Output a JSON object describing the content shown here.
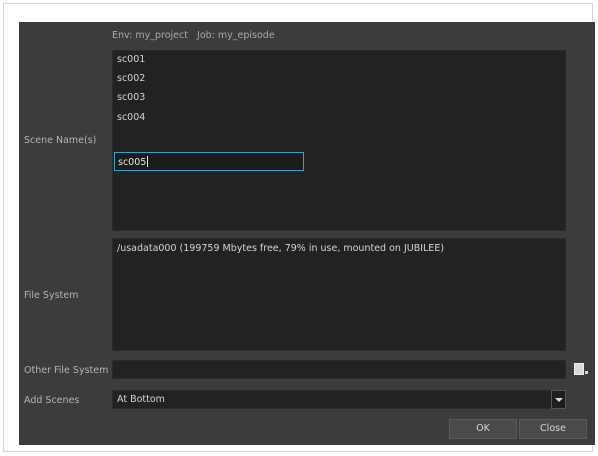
{
  "header": {
    "env_label": "Env: my_project",
    "job_label": "Job: my_episode"
  },
  "scene_names": {
    "label": "Scene Name(s)",
    "items": [
      "sc001",
      "sc002",
      "sc003",
      "sc004"
    ],
    "editing_value": "sc005"
  },
  "file_system": {
    "label": "File System",
    "entry": "/usadata000  (199759 Mbytes free, 79% in use, mounted on JUBILEE)"
  },
  "other_file_system": {
    "label": "Other File System",
    "value": ""
  },
  "add_scenes": {
    "label": "Add Scenes",
    "selected": "At Bottom"
  },
  "buttons": {
    "ok_label": "OK",
    "close_label": "Close"
  },
  "icons": {
    "browse": "folder-browse-icon",
    "dropdown": "chevron-down-icon"
  },
  "colors": {
    "dialog_bg": "#3c3c3c",
    "field_bg": "#222222",
    "focus_border": "#3aa0c8"
  }
}
